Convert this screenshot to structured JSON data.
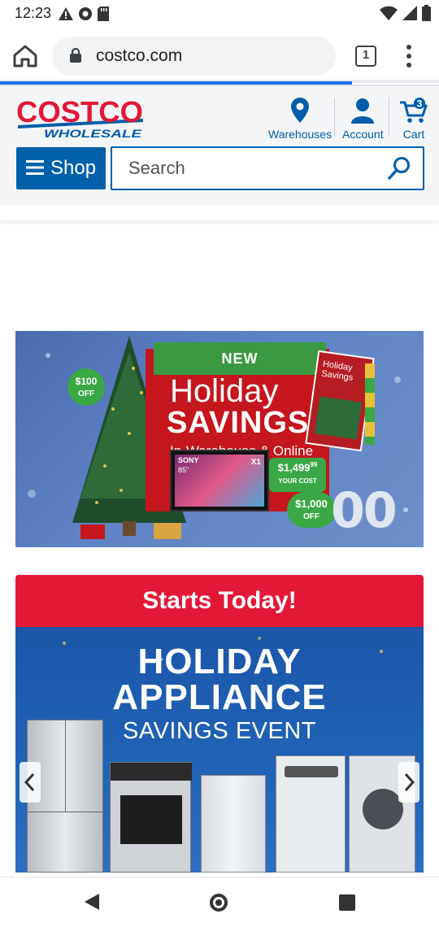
{
  "status_bar": {
    "time": "12:23"
  },
  "browser": {
    "url": "costco.com",
    "tab_count": "1"
  },
  "header": {
    "logo_text": "COSTCO",
    "logo_subtext": "WHOLESALE",
    "warehouses_label": "Warehouses",
    "account_label": "Account",
    "cart_label": "Cart",
    "cart_count": "3",
    "shop_label": "Shop",
    "search_placeholder": "Search"
  },
  "banner_holiday": {
    "tag": "NEW",
    "title_line1": "Holiday",
    "title_line2": "SAVINGS",
    "subtitle": "In-Warehouse & Online",
    "badge_amount": "$100",
    "badge_off": "OFF",
    "price": "$1,499",
    "price_cents": "99",
    "price_note": "YOUR COST",
    "off_amount": "$1,000",
    "off_label": "OFF",
    "tv_brand": "SONY",
    "tv_size": "85\"",
    "tv_chip": "X1",
    "big_digits": "00",
    "mag_title": "Holiday Savings"
  },
  "banner_appliance": {
    "header": "Starts Today!",
    "line1": "HOLIDAY",
    "line2": "APPLIANCE",
    "line3": "SAVINGS EVENT"
  },
  "colors": {
    "costco_blue": "#005daa",
    "costco_red": "#e31837",
    "promo_green": "#3aa844",
    "chrome_blue": "#1a73e8"
  }
}
